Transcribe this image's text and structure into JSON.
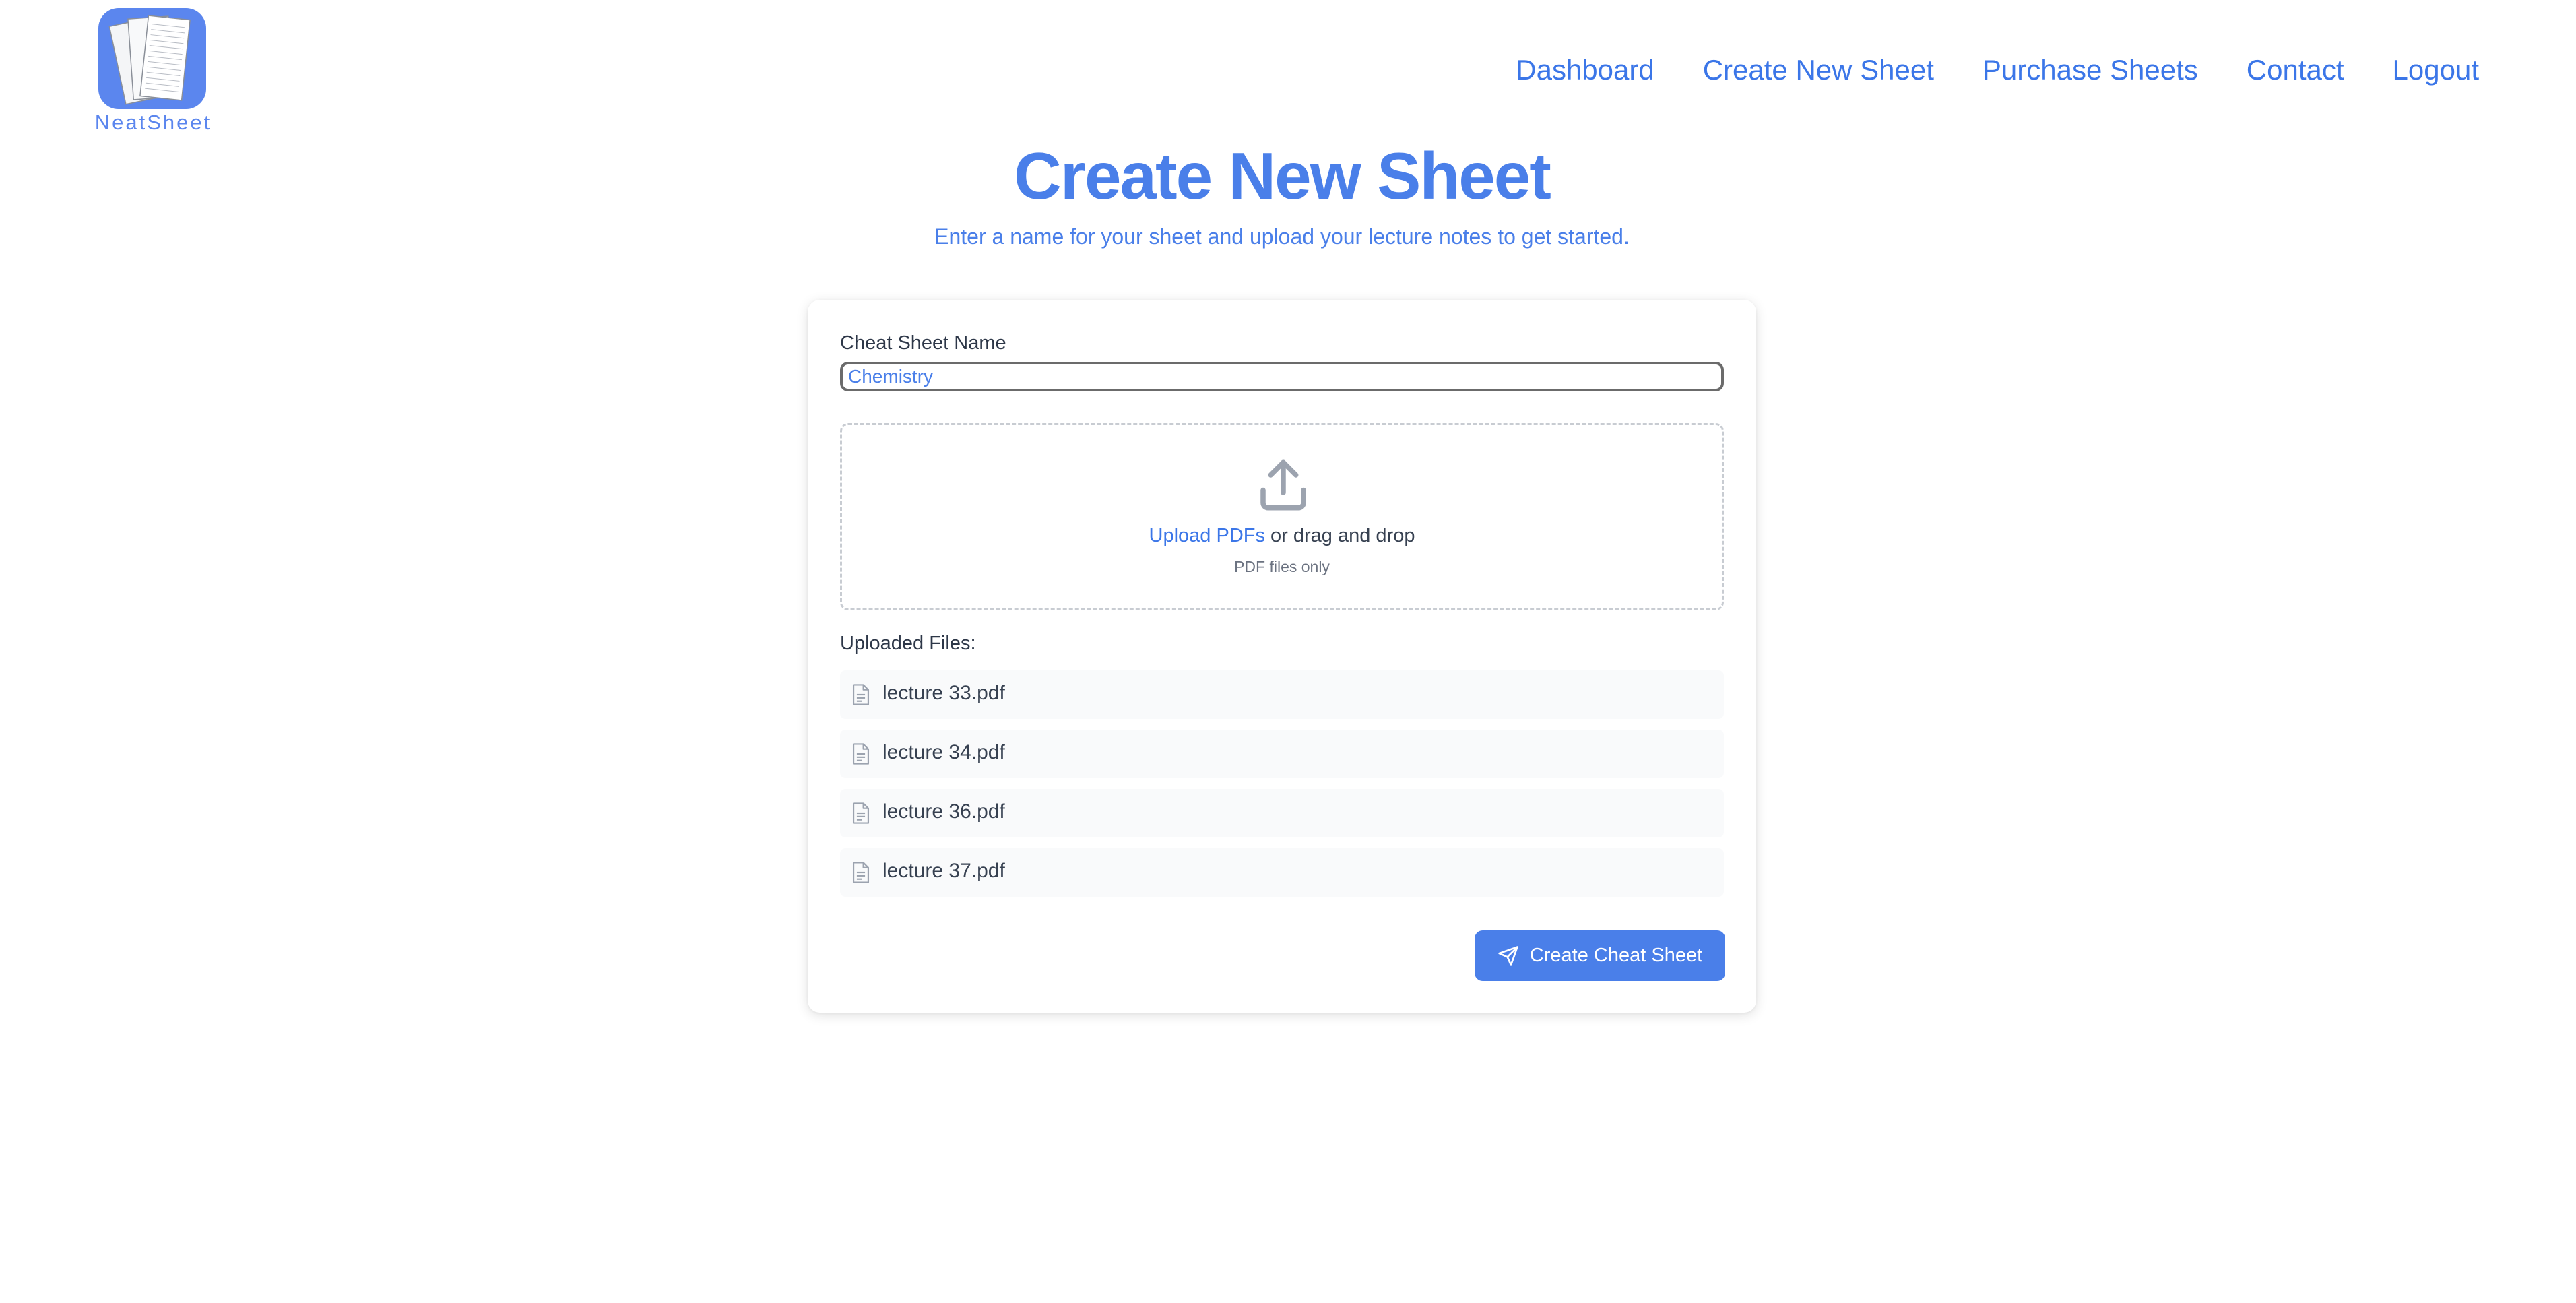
{
  "brand": {
    "name": "NeatSheet",
    "color": "#5b86ee",
    "logo_icon": "stacked-paper-sheets-icon"
  },
  "nav": {
    "items": [
      {
        "label": "Dashboard"
      },
      {
        "label": "Create New Sheet"
      },
      {
        "label": "Purchase Sheets"
      },
      {
        "label": "Contact"
      },
      {
        "label": "Logout"
      }
    ]
  },
  "page": {
    "title": "Create New Sheet",
    "subtitle": "Enter a name for your sheet and upload your lecture notes to get started."
  },
  "form": {
    "name_label": "Cheat Sheet Name",
    "name_value": "Chemistry",
    "dropzone": {
      "icon": "upload-icon",
      "link_text": "Upload PDFs",
      "rest_text": " or drag and drop",
      "hint": "PDF files only"
    },
    "uploaded_label": "Uploaded Files:",
    "files": [
      {
        "name": "lecture 33.pdf",
        "icon": "document-icon"
      },
      {
        "name": "lecture 34.pdf",
        "icon": "document-icon"
      },
      {
        "name": "lecture 36.pdf",
        "icon": "document-icon"
      },
      {
        "name": "lecture 37.pdf",
        "icon": "document-icon"
      }
    ],
    "submit_label": "Create Cheat Sheet",
    "submit_icon": "send-icon"
  },
  "colors": {
    "accent": "#4a7fe9",
    "nav_link": "#3b76e8",
    "file_row_bg": "#f9fafb"
  }
}
